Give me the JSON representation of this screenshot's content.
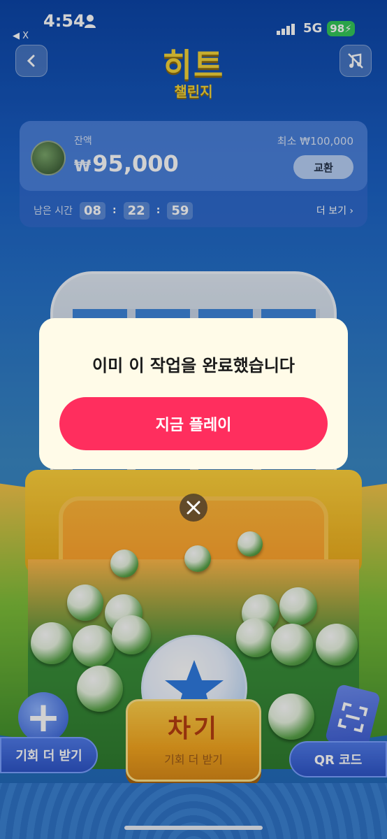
{
  "status_bar": {
    "time": "4:54",
    "back_app": "◀ X",
    "network": "5G",
    "battery": "98"
  },
  "header": {
    "title": "히트",
    "subtitle": "챌린지"
  },
  "balance": {
    "label": "잔액",
    "currency": "₩",
    "amount": "95,000",
    "min_label": "최소 ₩100,000",
    "exchange_label": "교환",
    "timer_label": "남은 시간",
    "timer_h": "08",
    "timer_m": "22",
    "timer_s": "59",
    "more_label": "더 보기 ›"
  },
  "game": {
    "kick_label": "차기",
    "kick_sub": "기회 더 받기",
    "more_chances": "기회 더 받기",
    "qr_label": "QR 코드"
  },
  "dialog": {
    "message": "이미 이 작업을 완료했습니다",
    "play_button": "지금 플레이"
  },
  "colors": {
    "play_button": "#ff2e5e",
    "title_gold": "#f3d43a",
    "dialog_bg": "#fffbe8"
  }
}
